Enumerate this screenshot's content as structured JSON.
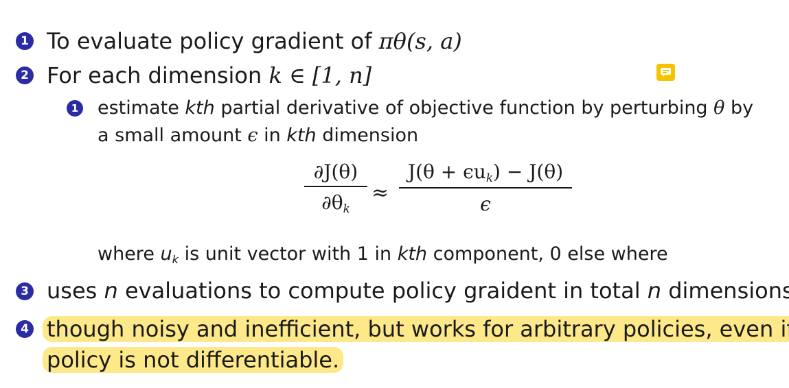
{
  "items": [
    {
      "bullet": "1",
      "text_plain": "To evaluate policy gradient of ",
      "math": "πθ(s, a)"
    },
    {
      "bullet": "2",
      "text_plain": "For each dimension ",
      "math": "k ∈ [1, n]",
      "sub_items": [
        {
          "bullet": "1",
          "line1_a": "estimate ",
          "line1_b": "kth",
          "line1_c": " partial derivative of objective function by perturbing ",
          "line1_d": "θ",
          "line1_e": " by",
          "line2_a": "a small amount ",
          "line2_b": "ϵ",
          "line2_c": " in ",
          "line2_d": "kth",
          "line2_e": " dimension"
        }
      ],
      "equation": {
        "lhs_num": "∂J(θ)",
        "lhs_den": "∂θ",
        "lhs_den_sub": "k",
        "relation": "≈",
        "rhs_num": "J(θ + ϵu",
        "rhs_num_sub": "k",
        "rhs_num_tail": ") − J(θ)",
        "rhs_den": "ϵ"
      },
      "where": {
        "a": "where ",
        "b": "u",
        "b_sub": "k",
        "c": " is unit vector with 1 in ",
        "d": "kth",
        "e": " component, 0 else where"
      }
    },
    {
      "bullet": "3",
      "a": "uses ",
      "b": "n",
      "c": " evaluations to compute policy graident in total ",
      "d": "n",
      "e": " dimensions"
    },
    {
      "bullet": "4",
      "line1": "though noisy and inefficient, but works for arbitrary policies, even if",
      "line2": "policy is not differentiable."
    }
  ],
  "colors": {
    "bullet": "#2b2ba6",
    "highlight": "#fde98a",
    "note_icon": "#f5c400"
  },
  "icons": {
    "note": "comment-note-icon"
  }
}
